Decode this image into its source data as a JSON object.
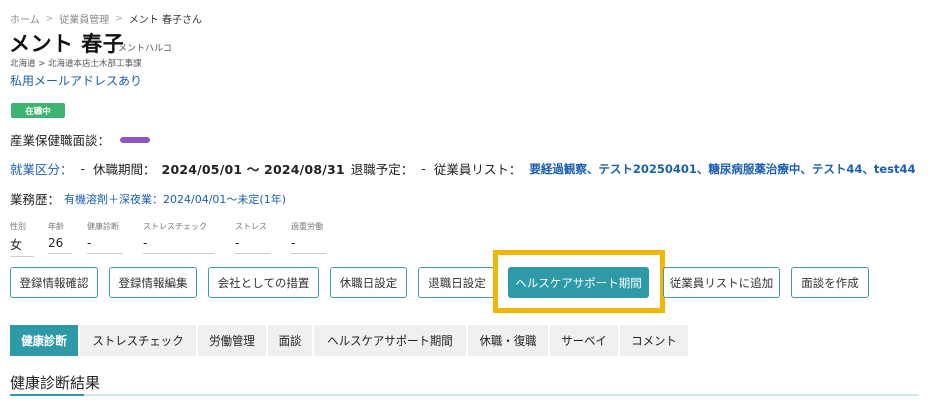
{
  "breadcrumb": {
    "items": [
      "ホーム",
      "従業員管理",
      "メント 春子さん"
    ],
    "separator": ">"
  },
  "employee": {
    "name": "メント 春子",
    "kana": "メントハルコ",
    "org": "北海道 > 北海道本店土木部工事課",
    "email_link": "私用メールアドレスあり",
    "status_badge": "在職中",
    "interview_label": "産業保健職面談：",
    "interview_color": "#8e56c2"
  },
  "info": {
    "employment_label": "就業区分：",
    "employment_value": "-",
    "leave_label": "休職期間：",
    "leave_value": "2024/05/01 ～ 2024/08/31",
    "retire_label": "退職予定：",
    "retire_value": "-",
    "list_label": "従業員リスト：",
    "list_value": "要経過観察、テスト20250401、糖尿病服薬治療中、テスト44、test44",
    "history_label": "業務歴：",
    "history_value": "有機溶剤＋深夜業：2024/04/01～未定(1年)"
  },
  "stats": [
    {
      "label": "性別",
      "value": "女"
    },
    {
      "label": "年齢",
      "value": "26"
    },
    {
      "label": "健康診断",
      "value": "-"
    },
    {
      "label": "ストレスチェック",
      "value": "-"
    },
    {
      "label": "ストレス",
      "value": "-"
    },
    {
      "label": "過重労働",
      "value": "-"
    }
  ],
  "actions": {
    "view_info": "登録情報確認",
    "edit_info": "登録情報編集",
    "company_measures": "会社としての措置",
    "leave_setting": "休職日設定",
    "retire_setting": "退職日設定",
    "healthcare_support": "ヘルスケアサポート期間",
    "add_to_list": "従業員リストに追加",
    "create_interview": "面談を作成"
  },
  "tabs": [
    {
      "label": "健康診断",
      "active": true
    },
    {
      "label": "ストレスチェック",
      "active": false
    },
    {
      "label": "労働管理",
      "active": false
    },
    {
      "label": "面談",
      "active": false
    },
    {
      "label": "ヘルスケアサポート期間",
      "active": false
    },
    {
      "label": "休職・復職",
      "active": false
    },
    {
      "label": "サーベイ",
      "active": false
    },
    {
      "label": "コメント",
      "active": false
    }
  ],
  "section": {
    "title": "健康診断結果"
  },
  "colors": {
    "accent": "#2e9aa7",
    "link": "#1a5fb4",
    "badge": "#3cb371",
    "highlight": "#f2b705"
  }
}
